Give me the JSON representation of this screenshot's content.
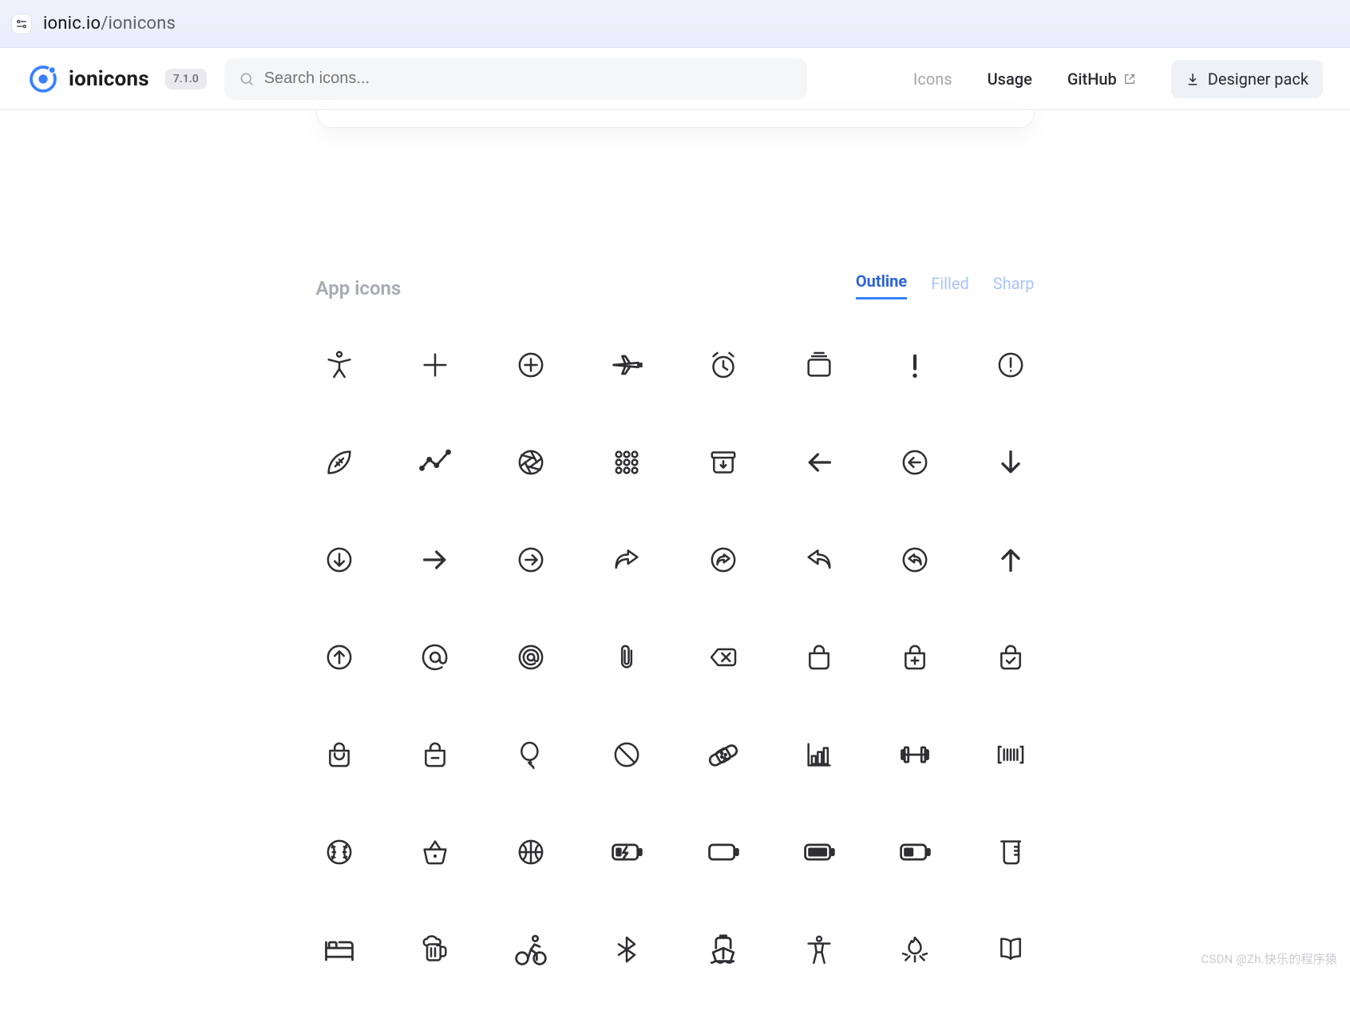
{
  "url": {
    "host": "ionic.io",
    "path": "/ionicons"
  },
  "brand": {
    "name": "ionicons",
    "version": "7.1.0"
  },
  "search": {
    "placeholder": "Search icons..."
  },
  "nav": {
    "icons": "Icons",
    "usage": "Usage",
    "github": "GitHub",
    "designer": "Designer pack"
  },
  "section": {
    "title": "App icons",
    "tabs": {
      "outline": "Outline",
      "filled": "Filled",
      "sharp": "Sharp"
    },
    "active_tab": "outline"
  },
  "icons_visible_count": 56,
  "rows_visible": 7,
  "columns": 8,
  "watermark": "CSDN @Zh.快乐的程序猿"
}
